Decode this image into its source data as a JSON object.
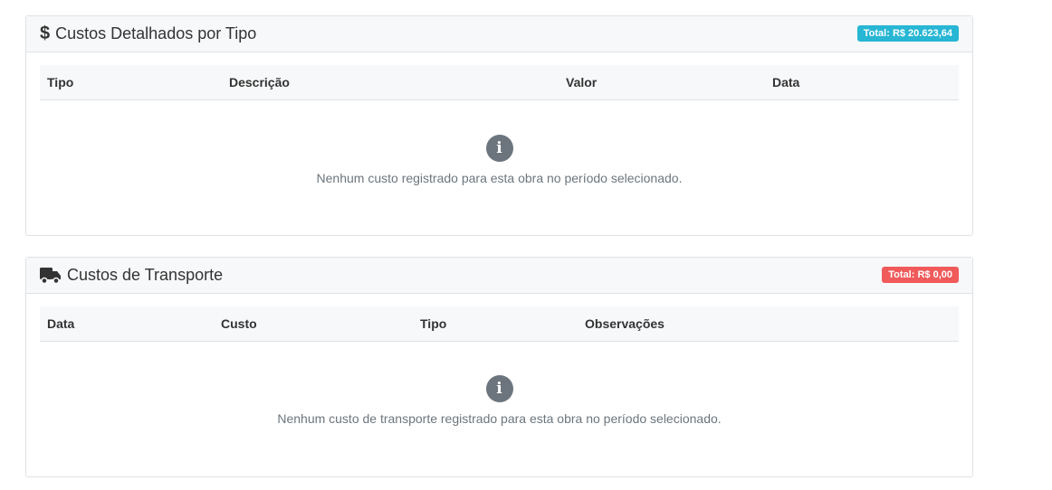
{
  "custos": {
    "title": "Custos Detalhados por Tipo",
    "icon": "dollar-icon",
    "icon_glyph": "$",
    "total": "Total: R$ 20.623,64",
    "badge_color": "#27b6d4",
    "columns": [
      "Tipo",
      "Descrição",
      "Valor",
      "Data"
    ],
    "empty": "Nenhum custo registrado para esta obra no período selecionado.",
    "info_glyph": "i"
  },
  "transporte": {
    "title": "Custos de Transporte",
    "icon": "truck-icon",
    "total": "Total: R$ 0,00",
    "badge_color": "#f05a5a",
    "columns": [
      "Data",
      "Custo",
      "Tipo",
      "Observações"
    ],
    "empty": "Nenhum custo de transporte registrado para esta obra no período selecionado.",
    "info_glyph": "i"
  }
}
